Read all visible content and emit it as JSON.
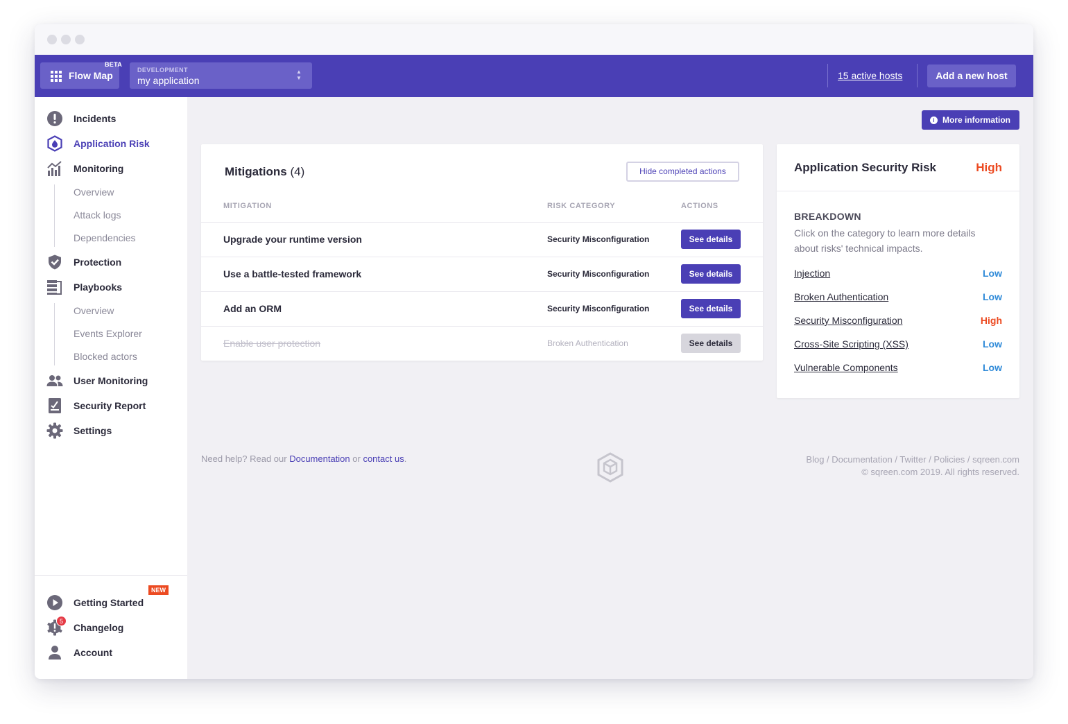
{
  "topbar": {
    "flowmap_label": "Flow Map",
    "beta_label": "BETA",
    "env_label": "DEVELOPMENT",
    "app_name": "my application",
    "hosts_link": "15 active hosts",
    "add_host_label": "Add a new host"
  },
  "sidebar": {
    "items": [
      {
        "label": "Incidents",
        "icon": "alert-circle-icon"
      },
      {
        "label": "Application Risk",
        "icon": "hexagon-shield-icon",
        "active": true
      },
      {
        "label": "Monitoring",
        "icon": "chart-bars-icon"
      },
      {
        "label": "Protection",
        "icon": "shield-check-icon"
      },
      {
        "label": "Playbooks",
        "icon": "playbook-icon"
      },
      {
        "label": "User Monitoring",
        "icon": "users-icon"
      },
      {
        "label": "Security Report",
        "icon": "report-icon"
      },
      {
        "label": "Settings",
        "icon": "gear-icon"
      }
    ],
    "monitoring_sub": [
      "Overview",
      "Attack logs",
      "Dependencies"
    ],
    "playbooks_sub": [
      "Overview",
      "Events Explorer",
      "Blocked actors"
    ],
    "bottom": [
      {
        "label": "Getting Started",
        "icon": "play-circle-icon",
        "badge": "NEW"
      },
      {
        "label": "Changelog",
        "icon": "changelog-icon",
        "count": "5"
      },
      {
        "label": "Account",
        "icon": "user-icon"
      }
    ]
  },
  "more_info_label": "More information",
  "mitigations": {
    "title": "Mitigations",
    "count": "(4)",
    "hide_button": "Hide completed actions",
    "columns": [
      "MITIGATION",
      "RISK CATEGORY",
      "ACTIONS"
    ],
    "rows": [
      {
        "mitigation": "Upgrade your runtime version",
        "category": "Security Misconfiguration",
        "action": "See details",
        "completed": false
      },
      {
        "mitigation": "Use a battle-tested framework",
        "category": "Security Misconfiguration",
        "action": "See details",
        "completed": false
      },
      {
        "mitigation": "Add an ORM",
        "category": "Security Misconfiguration",
        "action": "See details",
        "completed": false
      },
      {
        "mitigation": "Enable user protection",
        "category": "Broken Authentication",
        "action": "See details",
        "completed": true
      }
    ]
  },
  "risk": {
    "title": "Application Security Risk",
    "level": "High",
    "breakdown_title": "BREAKDOWN",
    "breakdown_desc": "Click on the category to learn more details about risks' technical impacts.",
    "items": [
      {
        "name": "Injection",
        "level": "Low"
      },
      {
        "name": "Broken Authentication",
        "level": "Low"
      },
      {
        "name": "Security Misconfiguration",
        "level": "High"
      },
      {
        "name": "Cross-Site Scripting (XSS)",
        "level": "Low"
      },
      {
        "name": "Vulnerable Components",
        "level": "Low"
      }
    ]
  },
  "footer": {
    "help_prefix": "Need help? Read our ",
    "doc_link": "Documentation",
    "or_text": " or ",
    "contact_link": "contact us",
    "period": ".",
    "links_line": "Blog / Documentation / Twitter / Policies / sqreen.com",
    "copyright": "© sqreen.com 2019. All rights reserved."
  },
  "colors": {
    "brand": "#4a3fb5",
    "high": "#ec4a21",
    "low": "#2f8ad8"
  }
}
